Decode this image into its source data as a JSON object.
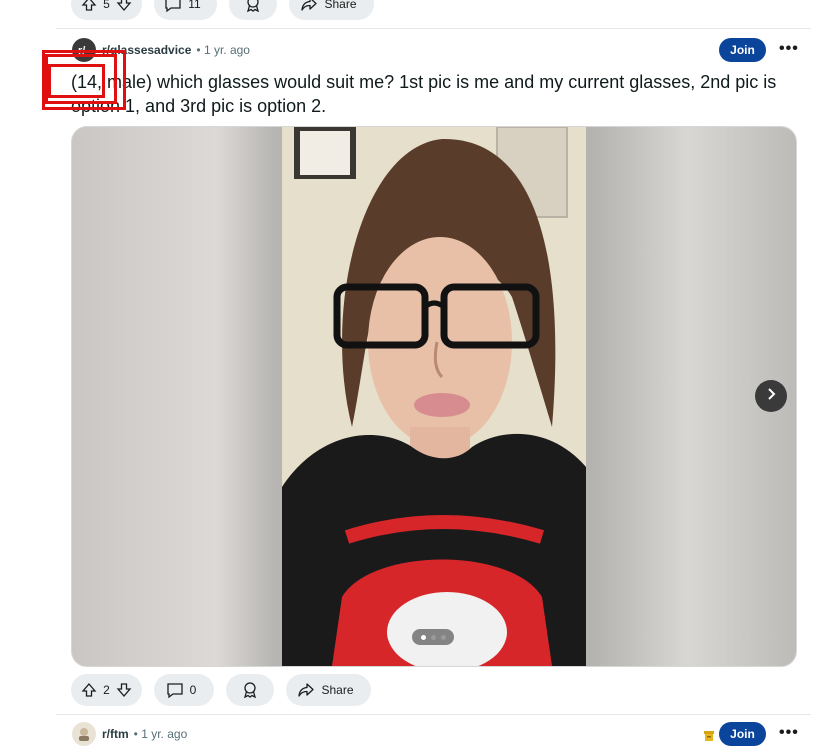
{
  "prev_post": {
    "upvote_count": "5",
    "comment_count": "11",
    "share_label": "Share"
  },
  "post": {
    "subreddit": "r/glassesadvice",
    "time": "1 yr. ago",
    "join_label": "Join",
    "more_label": "•••",
    "title": "(14, male) which glasses would suit me? 1st pic is me and my current glasses, 2nd pic is option 1, and 3rd pic is option 2.",
    "image_index": 1,
    "image_count": 3,
    "upvote_count": "2",
    "comment_count": "0",
    "share_label": "Share"
  },
  "next_post": {
    "subreddit": "r/ftm",
    "time": "1 yr. ago",
    "join_label": "Join",
    "more_label": "•••"
  },
  "colors": {
    "join_bg": "#0a449b",
    "pill_bg": "#eaedef",
    "highlight_box": "#e01010"
  },
  "icons": [
    "upvote-icon",
    "downvote-icon",
    "comment-icon",
    "award-icon",
    "share-icon",
    "chevron-right-icon",
    "subreddit-avatar-icon",
    "archive-icon"
  ]
}
